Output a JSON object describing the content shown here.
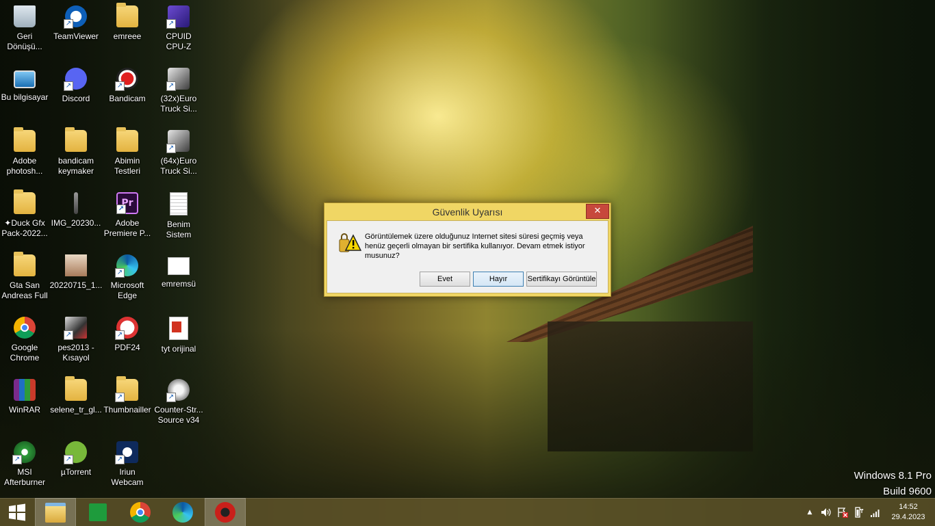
{
  "desktop": {
    "icons": [
      {
        "label": "Geri\nDönüşü...",
        "icon": "recycle-bin-icon"
      },
      {
        "label": "TeamViewer",
        "icon": "teamviewer-icon"
      },
      {
        "label": "emreee",
        "icon": "folder-icon"
      },
      {
        "label": "CPUID\nCPU-Z",
        "icon": "cpuz-icon"
      },
      {
        "label": "Bu bilgisayar",
        "icon": "computer-icon"
      },
      {
        "label": "Discord",
        "icon": "discord-icon"
      },
      {
        "label": "Bandicam",
        "icon": "bandicam-icon"
      },
      {
        "label": "(32x)Euro\nTruck Si...",
        "icon": "ets2-icon"
      },
      {
        "label": "Adobe\nphotosh...",
        "icon": "folder-icon"
      },
      {
        "label": "bandicam\nkeymaker",
        "icon": "folder-icon"
      },
      {
        "label": "Abimin\nTestleri",
        "icon": "folder-icon"
      },
      {
        "label": "(64x)Euro\nTruck Si...",
        "icon": "ets2-icon"
      },
      {
        "label": "✦Duck Gfx\nPack-2022...",
        "icon": "folder-icon"
      },
      {
        "label": "IMG_20230...",
        "icon": "image-icon"
      },
      {
        "label": "Adobe\nPremiere P...",
        "icon": "premiere-icon"
      },
      {
        "label": "Benim\nSistem",
        "icon": "text-file-icon"
      },
      {
        "label": "Gta San\nAndreas Full",
        "icon": "folder-icon"
      },
      {
        "label": "20220715_1...",
        "icon": "photo-icon"
      },
      {
        "label": "Microsoft\nEdge",
        "icon": "edge-icon"
      },
      {
        "label": "emremsü",
        "icon": "document-icon"
      },
      {
        "label": "Google\nChrome",
        "icon": "chrome-icon"
      },
      {
        "label": "pes2013 -\nKısayol",
        "icon": "pes-icon"
      },
      {
        "label": "PDF24",
        "icon": "pdf24-icon"
      },
      {
        "label": "tyt orijinal",
        "icon": "pdf-icon"
      },
      {
        "label": "WinRAR",
        "icon": "winrar-icon"
      },
      {
        "label": "selene_tr_gl...",
        "icon": "folder-icon"
      },
      {
        "label": "Thumbnailler",
        "icon": "folder-icon"
      },
      {
        "label": "Counter-Str...\nSource v34",
        "icon": "counter-strike-icon"
      },
      {
        "label": "MSI\nAfterburner",
        "icon": "msi-afterburner-icon"
      },
      {
        "label": "µTorrent",
        "icon": "utorrent-icon"
      },
      {
        "label": "Iriun\nWebcam",
        "icon": "webcam-icon"
      }
    ]
  },
  "dialog": {
    "title": "Güvenlik Uyarısı",
    "close_label": "✕",
    "message": "Görüntülemek üzere olduğunuz Internet sitesi süresi geçmiş veya henüz geçerli olmayan bir sertifika kullanıyor. Devam etmek istiyor musunuz?",
    "buttons": {
      "yes": "Evet",
      "no": "Hayır",
      "view_cert": "Sertifikayı Görüntüle"
    }
  },
  "watermark": {
    "line1": "Windows 8.1 Pro",
    "line2": "Build 9600"
  },
  "taskbar": {
    "apps": [
      "start-icon",
      "file-explorer-icon",
      "store-icon",
      "chrome-icon",
      "edge-icon",
      "bandicam-icon"
    ],
    "clock": {
      "time": "14:52",
      "date": "29.4.2023"
    }
  },
  "colors": {
    "dialog_frame": "#f0d664",
    "close": "#c7483c",
    "taskbar": "#564c26"
  }
}
